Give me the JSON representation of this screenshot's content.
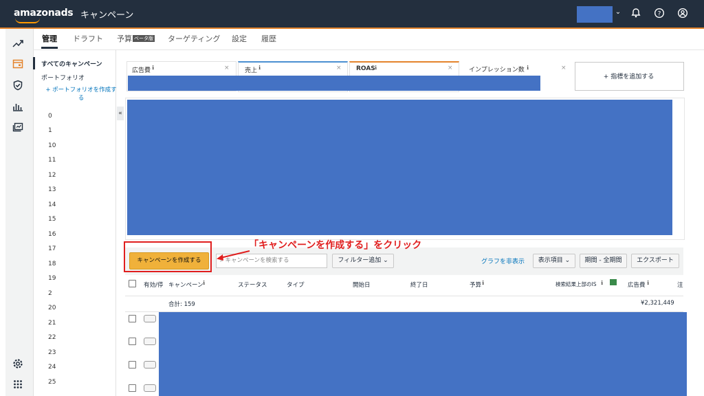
{
  "header": {
    "logo": "amazonads",
    "title": "キャンペーン"
  },
  "tabs": [
    {
      "label": "管理"
    },
    {
      "label": "ドラフト"
    },
    {
      "label": "予算"
    },
    {
      "label": "ターゲティング"
    },
    {
      "label": "設定"
    },
    {
      "label": "履歴"
    }
  ],
  "beta_badge": "ベータ版",
  "sidebar": {
    "all_campaigns": "すべてのキャンペーン",
    "portfolio": "ポートフォリオ",
    "create_portfolio": "+ ポートフォリオを作成する",
    "items": [
      "0",
      "1",
      "10",
      "11",
      "12",
      "13",
      "14",
      "15",
      "16",
      "17",
      "18",
      "19",
      "2",
      "20",
      "21",
      "22",
      "23",
      "24",
      "25"
    ]
  },
  "metrics": [
    {
      "label": "広告費",
      "accent": "#e2e2e2"
    },
    {
      "label": "売上",
      "accent": "#4a8fd1"
    },
    {
      "label": "ROAS",
      "accent": "#e4832b"
    },
    {
      "label": "インプレッション数",
      "accent": "#e2e2e2"
    }
  ],
  "add_metric": "+ 指標を追加する",
  "toolbar": {
    "create_campaign": "キャンペーンを作成する",
    "search_placeholder": "キャンペーンを検索する",
    "filter": "フィルター追加",
    "hide_graph": "グラフを非表示",
    "columns": "表示項目",
    "period": "期間 - 全期間",
    "export": "エクスポート"
  },
  "annotation": "「キャンペーンを作成する」をクリック",
  "table": {
    "headers": [
      "有効/停",
      "キャンペーン",
      "ステータス",
      "タイプ",
      "開始日",
      "終了日",
      "予算",
      "検索結果上部のIS",
      "広告費",
      "注"
    ],
    "total_label": "合計: 159",
    "total_spend": "¥2,321,449"
  },
  "colors": {
    "nav_bg": "#232f3e",
    "accent": "#e4832b",
    "redacted": "#4472c4",
    "create_button": "#f0b13a",
    "annotation": "#e01e1e"
  }
}
